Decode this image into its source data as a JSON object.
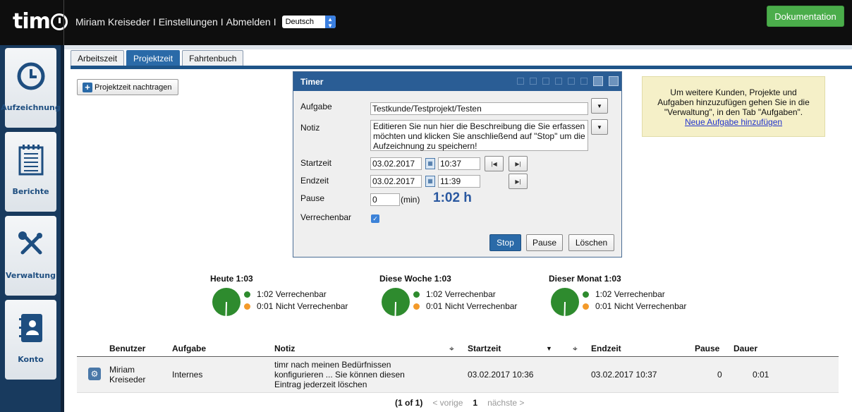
{
  "header": {
    "logo": "timr",
    "user": "Miriam Kreiseder",
    "sep": "I",
    "settings": "Einstellungen",
    "logout": "Abmelden",
    "language": "Deutsch",
    "doc_button": "Dokumentation"
  },
  "nav": [
    {
      "label": "Aufzeichnung",
      "icon": "clock-icon"
    },
    {
      "label": "Berichte",
      "icon": "notepad-icon"
    },
    {
      "label": "Verwaltung",
      "icon": "tools-icon"
    },
    {
      "label": "Konto",
      "icon": "contact-book-icon"
    }
  ],
  "tabs": [
    "Arbeitszeit",
    "Projektzeit",
    "Fahrtenbuch"
  ],
  "add_button": "Projektzeit nachtragen",
  "timer": {
    "title": "Timer",
    "labels": {
      "aufgabe": "Aufgabe",
      "notiz": "Notiz",
      "startzeit": "Startzeit",
      "endzeit": "Endzeit",
      "pause": "Pause",
      "verrechenbar": "Verrechenbar"
    },
    "aufgabe_value": "Testkunde/Testprojekt/Testen",
    "notiz_value": "Editieren Sie nun hier die Beschreibung die Sie erfassen möchten und klicken Sie anschließend auf \"Stop\" um die Aufzeichnung zu speichern!",
    "start_date": "03.02.2017",
    "start_time": "10:37",
    "end_date": "03.02.2017",
    "end_time": "11:39",
    "pause_value": "0",
    "pause_unit": "(min)",
    "duration": "1:02 h",
    "verrechenbar_checked": true,
    "buttons": {
      "stop": "Stop",
      "pause": "Pause",
      "loeschen": "Löschen"
    }
  },
  "info": {
    "line1": "Um weitere Kunden, Projekte und",
    "line2": "Aufgaben hinzuzufügen gehen Sie in die",
    "line3": "\"Verwaltung\", in den Tab \"Aufgaben\".",
    "link": "Neue Aufgabe hinzufügen"
  },
  "summaries": [
    {
      "title": "Heute 1:03",
      "billable": "1:02 Verrechenbar",
      "nonbillable": "0:01 Nicht Verrechenbar"
    },
    {
      "title": "Diese Woche 1:03",
      "billable": "1:02 Verrechenbar",
      "nonbillable": "0:01 Nicht Verrechenbar"
    },
    {
      "title": "Dieser Monat 1:03",
      "billable": "1:02 Verrechenbar",
      "nonbillable": "0:01 Nicht Verrechenbar"
    }
  ],
  "colors": {
    "billable": "#2e8b2e",
    "nonbillable": "#f39a2a",
    "accent": "#2a6aa8"
  },
  "table": {
    "headers": [
      "Benutzer",
      "Aufgabe",
      "Notiz",
      "Startzeit",
      "Endzeit",
      "Pause",
      "Dauer"
    ],
    "row": {
      "benutzer_1": "Miriam",
      "benutzer_2": "Kreiseder",
      "aufgabe": "Internes",
      "notiz_1": "timr nach meinen Bedürfnissen",
      "notiz_2": "konfigurieren ... Sie können diesen",
      "notiz_3": "Eintrag jederzeit löschen",
      "start": "03.02.2017 10:36",
      "end": "03.02.2017 10:37",
      "pause": "0",
      "dauer": "0:01"
    }
  },
  "pager": {
    "info": "(1 of 1)",
    "prev": "< vorige",
    "page": "1",
    "next": "nächste >"
  }
}
